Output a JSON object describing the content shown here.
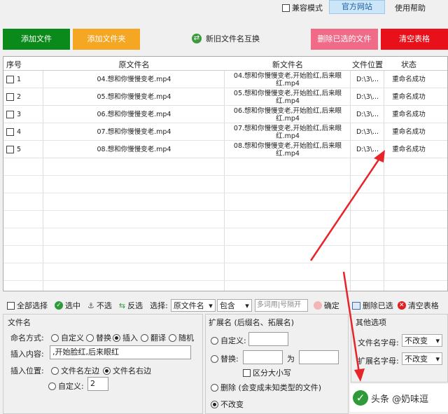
{
  "topbar": {
    "compat_label": "兼容模式",
    "official_label": "官方网站",
    "help_label": "使用帮助",
    "minimize_label": "—",
    "close_label": "✕"
  },
  "actions": {
    "add_file": "添加文件",
    "add_folder": "添加文件夹",
    "swap_names": "新旧文件名互换",
    "delete_selected": "删除已选的文件",
    "clear_table": "清空表格"
  },
  "colors": {
    "green": "#0a8a1a",
    "orange": "#f5a623",
    "pink": "#f06b87",
    "red": "#e8101a"
  },
  "table": {
    "headers": [
      "序号",
      "原文件名",
      "新文件名",
      "文件位置",
      "状态"
    ],
    "rows": [
      {
        "no": "1",
        "old": "04.想和你慢慢变老.mp4",
        "new1": "04.想和你慢慢变老,开始脸红,后来眼",
        "new2": "红.mp4",
        "loc": "D:\\3\\...",
        "status": "重命名成功"
      },
      {
        "no": "2",
        "old": "05.想和你慢慢变老.mp4",
        "new1": "05.想和你慢慢变老,开始脸红,后来眼",
        "new2": "红.mp4",
        "loc": "D:\\3\\...",
        "status": "重命名成功"
      },
      {
        "no": "3",
        "old": "06.想和你慢慢变老.mp4",
        "new1": "06.想和你慢慢变老,开始脸红,后来眼",
        "new2": "红.mp4",
        "loc": "D:\\3\\...",
        "status": "重命名成功"
      },
      {
        "no": "4",
        "old": "07.想和你慢慢变老.mp4",
        "new1": "07.想和你慢慢变老,开始脸红,后来眼",
        "new2": "红.mp4",
        "loc": "D:\\3\\...",
        "status": "重命名成功"
      },
      {
        "no": "5",
        "old": "08.想和你慢慢变老.mp4",
        "new1": "08.想和你慢慢变老,开始脸红,后来眼",
        "new2": "红.mp4",
        "loc": "D:\\3\\...",
        "status": "重命名成功"
      }
    ]
  },
  "selectbar": {
    "select_all": "全部选择",
    "check": "选中",
    "uncheck": "不选",
    "invert": "反选",
    "select_label": "选择:",
    "field_value": "原文件名",
    "match_value": "包含",
    "keyword_placeholder": "多词用|号隔开",
    "confirm": "确定",
    "delete_checked": "删除已选",
    "clear": "清空表格"
  },
  "filename_panel": {
    "title": "文件名",
    "mode_label": "命名方式:",
    "modes": [
      "自定义",
      "替换",
      "插入",
      "翻译",
      "随机"
    ],
    "content_label": "插入内容:",
    "content_value": ",开始脸红,后来眼红",
    "position_label": "插入位置:",
    "pos_left": "文件名左边",
    "pos_right": "文件名右边",
    "pos_custom": "自定义:",
    "pos_custom_value": "2"
  },
  "ext_panel": {
    "title": "扩展名 (后缀名、拓展名)",
    "custom": "自定义:",
    "replace": "替换:",
    "to": "为",
    "case_sensitive": "区分大小写",
    "delete": "删除 (会变成未知类型的文件)",
    "keep": "不改变"
  },
  "other_panel": {
    "title": "其他选项",
    "name_case_label": "文件名字母:",
    "name_case_value": "不改变",
    "ext_case_label": "扩展名字母:",
    "ext_case_value": "不改变"
  },
  "watermark": {
    "text": "头条 @奶味逗"
  }
}
